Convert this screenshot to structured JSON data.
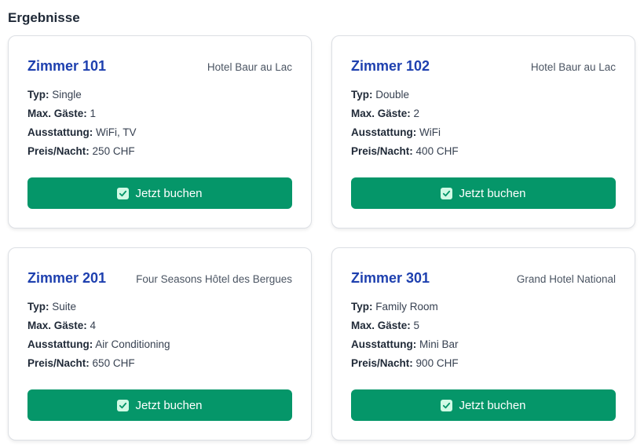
{
  "page": {
    "heading": "Ergebnisse"
  },
  "labels": {
    "type": "Typ:",
    "guests": "Max. Gäste:",
    "amenities": "Ausstattung:",
    "price": "Preis/Nacht:"
  },
  "rooms": [
    {
      "title": "Zimmer 101",
      "hotel": "Hotel Baur au Lac",
      "type": "Single",
      "guests": "1",
      "amenities": "WiFi, TV",
      "price": "250 CHF",
      "button": "Jetzt buchen"
    },
    {
      "title": "Zimmer 102",
      "hotel": "Hotel Baur au Lac",
      "type": "Double",
      "guests": "2",
      "amenities": "WiFi",
      "price": "400 CHF",
      "button": "Jetzt buchen"
    },
    {
      "title": "Zimmer 201",
      "hotel": "Four Seasons Hôtel des Bergues",
      "type": "Suite",
      "guests": "4",
      "amenities": "Air Conditioning",
      "price": "650 CHF",
      "button": "Jetzt buchen"
    },
    {
      "title": "Zimmer 301",
      "hotel": "Grand Hotel National",
      "type": "Family Room",
      "guests": "5",
      "amenities": "Mini Bar",
      "price": "900 CHF",
      "button": "Jetzt buchen"
    }
  ],
  "colors": {
    "accent_title": "#1e40af",
    "button_bg": "#059669",
    "check_icon_bg": "#d1fae5"
  },
  "icons": {
    "button_icon": "check-icon"
  }
}
